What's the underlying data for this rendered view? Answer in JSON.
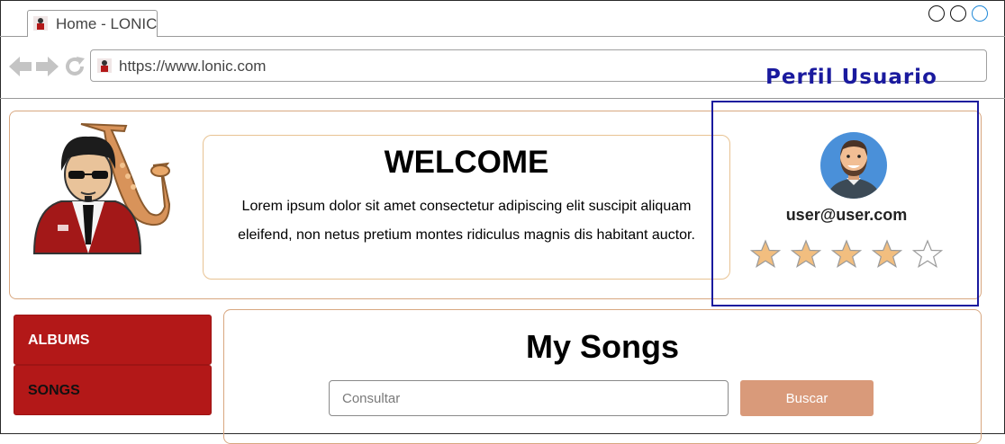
{
  "browser": {
    "tab_title": "Home - LONIC",
    "url": "https://www.lonic.com"
  },
  "annotation": {
    "profile_title": "Perfil Usuario"
  },
  "header": {
    "welcome_title": "WELCOME",
    "welcome_text": "Lorem ipsum dolor sit amet consectetur adipiscing elit suscipit aliquam eleifend, non netus pretium montes ridiculus magnis dis habitant auctor."
  },
  "user": {
    "email": "user@user.com",
    "rating": 4,
    "rating_max": 5
  },
  "sidebar": {
    "items": [
      {
        "label": "ALBUMS"
      },
      {
        "label": "SONGS"
      }
    ]
  },
  "main": {
    "title": "My Songs",
    "search_placeholder": "Consultar",
    "search_button": "Buscar"
  },
  "colors": {
    "sidebar_button": "#b31818",
    "search_button": "#d99a7a",
    "star_fill": "#f2be7f",
    "card_border": "#d8a780",
    "annotation": "#1a1a9e"
  },
  "icons": {
    "back": "arrow-left-icon",
    "forward": "arrow-right-icon",
    "reload": "reload-icon",
    "favicon": "musician-favicon-icon"
  }
}
